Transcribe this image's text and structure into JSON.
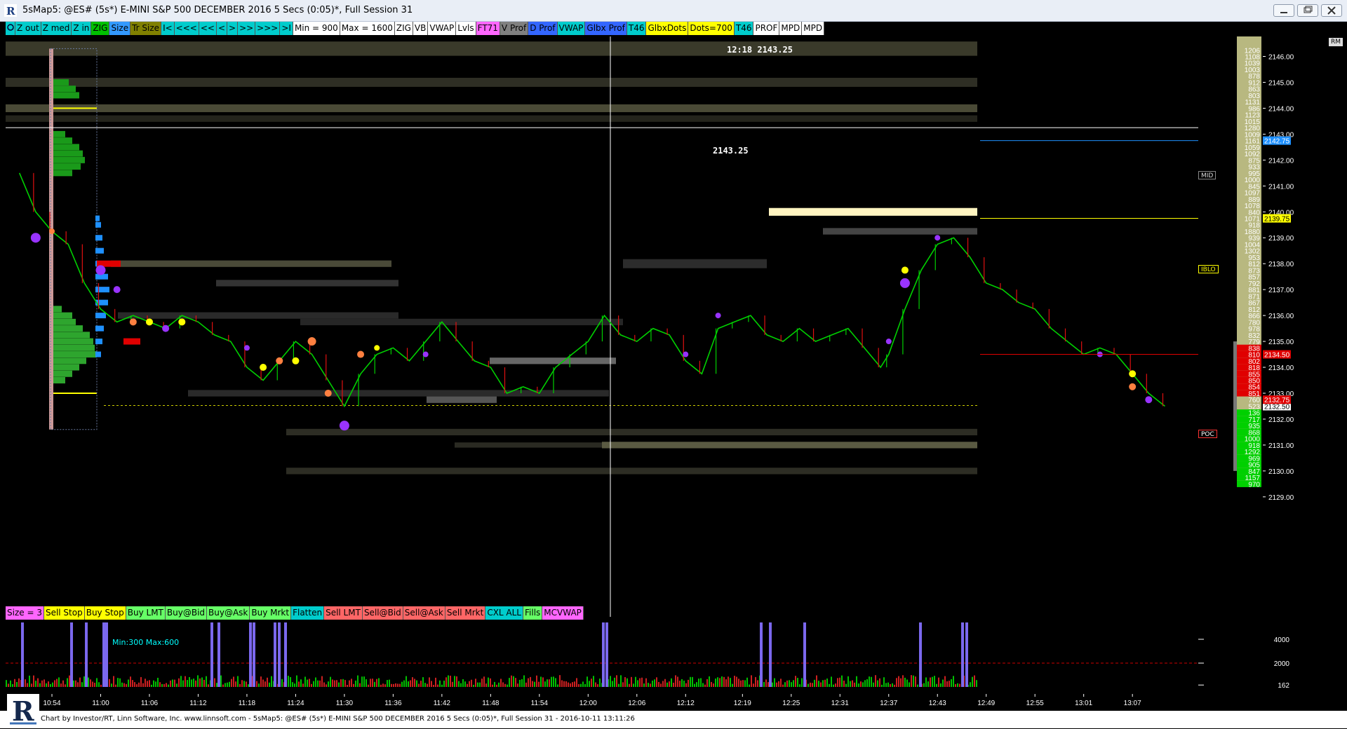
{
  "window": {
    "title": "5sMap5: @ES# (5s*) E-MINI S&P 500 DECEMBER 2016 5 Secs (0:05)*, Full Session 31",
    "app_icon": "investor-rt-icon",
    "buttons": [
      "minimize-icon",
      "restore-icon",
      "close-icon"
    ]
  },
  "toolbar": [
    {
      "label": "Z out",
      "bg": "#00cccc",
      "icon": "chart-settings-icon"
    },
    {
      "label": "Z med",
      "bg": "#00cccc"
    },
    {
      "label": "Z in",
      "bg": "#00cccc"
    },
    {
      "label": "ZIG",
      "bg": "#00c000"
    },
    {
      "label": "Size",
      "bg": "#3399ff"
    },
    {
      "label": "Tr Size",
      "bg": "#808000"
    },
    {
      "label": "I<",
      "bg": "#00cccc"
    },
    {
      "label": "<<<",
      "bg": "#00cccc"
    },
    {
      "label": "<<",
      "bg": "#00cccc"
    },
    {
      "label": "<",
      "bg": "#00cccc"
    },
    {
      "label": ">",
      "bg": "#00cccc"
    },
    {
      "label": ">>",
      "bg": "#00cccc"
    },
    {
      "label": ">>>",
      "bg": "#00cccc"
    },
    {
      "label": ">I",
      "bg": "#00cccc"
    },
    {
      "label": "Min = 900",
      "bg": "#ffffff"
    },
    {
      "label": "Max = 1600",
      "bg": "#ffffff"
    },
    {
      "label": "ZIG",
      "bg": "#ffffff"
    },
    {
      "label": "VB",
      "bg": "#ffffff"
    },
    {
      "label": "VWAP",
      "bg": "#ffffff"
    },
    {
      "label": "Lvls",
      "bg": "#ffffff"
    },
    {
      "label": "FT71",
      "bg": "#ff66ff"
    },
    {
      "label": "V Prof",
      "bg": "#808080"
    },
    {
      "label": "D Prof",
      "bg": "#3366ff"
    },
    {
      "label": "VWAP",
      "bg": "#00cccc"
    },
    {
      "label": "Glbx Prof",
      "bg": "#3366ff"
    },
    {
      "label": "T46",
      "bg": "#00cccc"
    },
    {
      "label": "GlbxDots",
      "bg": "#ffff00"
    },
    {
      "label": "Dots=700",
      "bg": "#ffff00"
    },
    {
      "label": "T46",
      "bg": "#00cccc"
    },
    {
      "label": "PROF",
      "bg": "#ffffff"
    },
    {
      "label": "MPD",
      "bg": "#ffffff"
    },
    {
      "label": "MPD",
      "bg": "#ffffff"
    }
  ],
  "overlays": {
    "crosshair_label": "12:18  2143.25",
    "price_line_label": "2143.25",
    "volume_minmax": "Min:300 Max:600"
  },
  "right_scale": {
    "price_ticks": [
      {
        "price": 2146,
        "label": "2146.00"
      },
      {
        "price": 2145,
        "label": "2145.00"
      },
      {
        "price": 2144,
        "label": "2144.00"
      },
      {
        "price": 2143,
        "label": "2143.00"
      },
      {
        "price": 2142,
        "label": "2142.00"
      },
      {
        "price": 2141,
        "label": "2141.00"
      },
      {
        "price": 2140,
        "label": "2140.00"
      },
      {
        "price": 2139,
        "label": "2139.00"
      },
      {
        "price": 2138,
        "label": "2138.00"
      },
      {
        "price": 2137,
        "label": "2137.00"
      },
      {
        "price": 2136,
        "label": "2136.00"
      },
      {
        "price": 2135,
        "label": "2135.00"
      },
      {
        "price": 2134,
        "label": "2134.00"
      },
      {
        "price": 2133,
        "label": "2133.00"
      },
      {
        "price": 2132,
        "label": "2132.00"
      },
      {
        "price": 2131,
        "label": "2131.00"
      },
      {
        "price": 2130,
        "label": "2130.00"
      },
      {
        "price": 2129,
        "label": "2129.00"
      }
    ],
    "ladder_volumes": [
      "1206",
      "1108",
      "1039",
      "1003",
      "878",
      "912",
      "863",
      "803",
      "1131",
      "986",
      "1123",
      "1015",
      "1280",
      "1009",
      "1161",
      "1059",
      "1092",
      "875",
      "933",
      "995",
      "1000",
      "845",
      "1097",
      "889",
      "1078",
      "840",
      "1071",
      "918",
      "1880",
      "939",
      "1004",
      "1302",
      "953",
      "812",
      "873",
      "857",
      "792",
      "881",
      "871",
      "867",
      "812",
      "866",
      "780",
      "978",
      "832",
      "779",
      "838",
      "810",
      "802",
      "818",
      "855",
      "850",
      "854",
      "851",
      "760",
      "523",
      "136",
      "717",
      "935",
      "868",
      "1000",
      "918",
      "1292",
      "969",
      "905",
      "847",
      "1157",
      "970"
    ],
    "mid_tag": "MID",
    "mid_price": "2142.75",
    "iblo_tag": "IBLO",
    "iblo_price": "2139.75",
    "poc_tag": "POC",
    "poc_price": "2134.50",
    "last_price": "2132.50",
    "current_bid": "2132.75",
    "corner_label": "RM",
    "volume_ticks": [
      {
        "value": 4000,
        "label": "4000"
      },
      {
        "value": 2000,
        "label": "2000"
      },
      {
        "value": 162,
        "label": "162"
      }
    ]
  },
  "order_bar": [
    {
      "label": "Size = 3",
      "bg": "#ff66ff"
    },
    {
      "label": "Sell Stop",
      "bg": "#ffff00"
    },
    {
      "label": "Buy Stop",
      "bg": "#ffff00"
    },
    {
      "label": "Buy LMT",
      "bg": "#66ff66"
    },
    {
      "label": "Buy@Bid",
      "bg": "#66ff66"
    },
    {
      "label": "Buy@Ask",
      "bg": "#66ff66"
    },
    {
      "label": "Buy Mrkt",
      "bg": "#66ff66"
    },
    {
      "label": "Flatten",
      "bg": "#00cccc"
    },
    {
      "label": "Sell LMT",
      "bg": "#ff6666"
    },
    {
      "label": "Sell@Bid",
      "bg": "#ff6666"
    },
    {
      "label": "Sell@Ask",
      "bg": "#ff6666"
    },
    {
      "label": "Sell Mrkt",
      "bg": "#ff6666"
    },
    {
      "label": "CXL ALL",
      "bg": "#00cccc"
    },
    {
      "label": "Fills",
      "bg": "#66ff66"
    },
    {
      "label": "MCVWAP",
      "bg": "#ff66ff"
    }
  ],
  "time_axis": [
    "10:54",
    "11:00",
    "11:06",
    "11:12",
    "11:18",
    "11:24",
    "11:30",
    "11:36",
    "11:42",
    "11:48",
    "11:54",
    "12:00",
    "12:06",
    "12:12",
    "12:19",
    "12:25",
    "12:31",
    "12:37",
    "12:43",
    "12:49",
    "12:55",
    "13:01",
    "13:07"
  ],
  "footer": "Chart by Investor/RT, Linn Software, Inc. www.linnsoft.com - 5sMap5: @ES# (5s*) E-MINI S&P 500 DECEMBER 2016 5 Secs (0:05)*, Full Session 31 - 2016-10-11 13:11:26",
  "chart_data": {
    "type": "line",
    "title": "",
    "xlabel": "",
    "ylabel": "",
    "ylim": [
      2128.5,
      2147.2
    ],
    "x": [
      "10:50",
      "10:52",
      "10:54",
      "10:56",
      "10:58",
      "11:00",
      "11:02",
      "11:04",
      "11:06",
      "11:08",
      "11:10",
      "11:12",
      "11:14",
      "11:16",
      "11:18",
      "11:20",
      "11:22",
      "11:24",
      "11:26",
      "11:28",
      "11:30",
      "11:32",
      "11:34",
      "11:36",
      "11:38",
      "11:40",
      "11:42",
      "11:44",
      "11:46",
      "11:48",
      "11:50",
      "11:52",
      "11:54",
      "11:56",
      "11:58",
      "12:00",
      "12:02",
      "12:04",
      "12:06",
      "12:08",
      "12:10",
      "12:12",
      "12:14",
      "12:16",
      "12:18",
      "12:20",
      "12:22",
      "12:24",
      "12:26",
      "12:28",
      "12:30",
      "12:32",
      "12:34",
      "12:36",
      "12:37",
      "12:39",
      "12:41",
      "12:43",
      "12:45",
      "12:47",
      "12:49",
      "12:51",
      "12:53",
      "12:55",
      "12:57",
      "12:59",
      "13:01",
      "13:03",
      "13:05",
      "13:07",
      "13:09",
      "13:11"
    ],
    "series": [
      {
        "values": [
          2141.5,
          2140.0,
          2139.25,
          2138.75,
          2137.25,
          2136.25,
          2135.75,
          2136.0,
          2135.75,
          2135.5,
          2136.0,
          2135.75,
          2135.25,
          2135.0,
          2134.0,
          2133.5,
          2134.25,
          2135.0,
          2134.5,
          2133.5,
          2132.5,
          2133.75,
          2134.5,
          2134.75,
          2134.25,
          2135.0,
          2135.75,
          2135.0,
          2134.25,
          2134.0,
          2133.0,
          2133.25,
          2133.0,
          2134.0,
          2134.5,
          2135.0,
          2136.0,
          2135.25,
          2135.0,
          2135.5,
          2135.25,
          2134.25,
          2133.75,
          2135.5,
          2135.75,
          2136.0,
          2135.25,
          2135.0,
          2135.5,
          2135.0,
          2135.25,
          2135.5,
          2134.75,
          2134.0,
          2134.5,
          2136.25,
          2137.75,
          2138.75,
          2139.0,
          2138.25,
          2137.25,
          2137.0,
          2136.5,
          2136.25,
          2135.5,
          2135.0,
          2134.5,
          2134.75,
          2134.5,
          2133.75,
          2133.0,
          2132.5
        ]
      }
    ],
    "reference_levels": {
      "mid": 2142.75,
      "iblo": 2139.75,
      "poc": 2134.5,
      "last": 2132.5,
      "horizontal_line": 2143.25
    },
    "volume": {
      "max": 4000,
      "threshold": 2000,
      "min": 162
    }
  },
  "colors": {
    "price_up": "#00d000",
    "price_down": "#e01010",
    "volume_highlight": "#7b68ee",
    "poc": "#e00000",
    "mid_line": "#3399ff",
    "iblo_line": "#ffff00"
  }
}
